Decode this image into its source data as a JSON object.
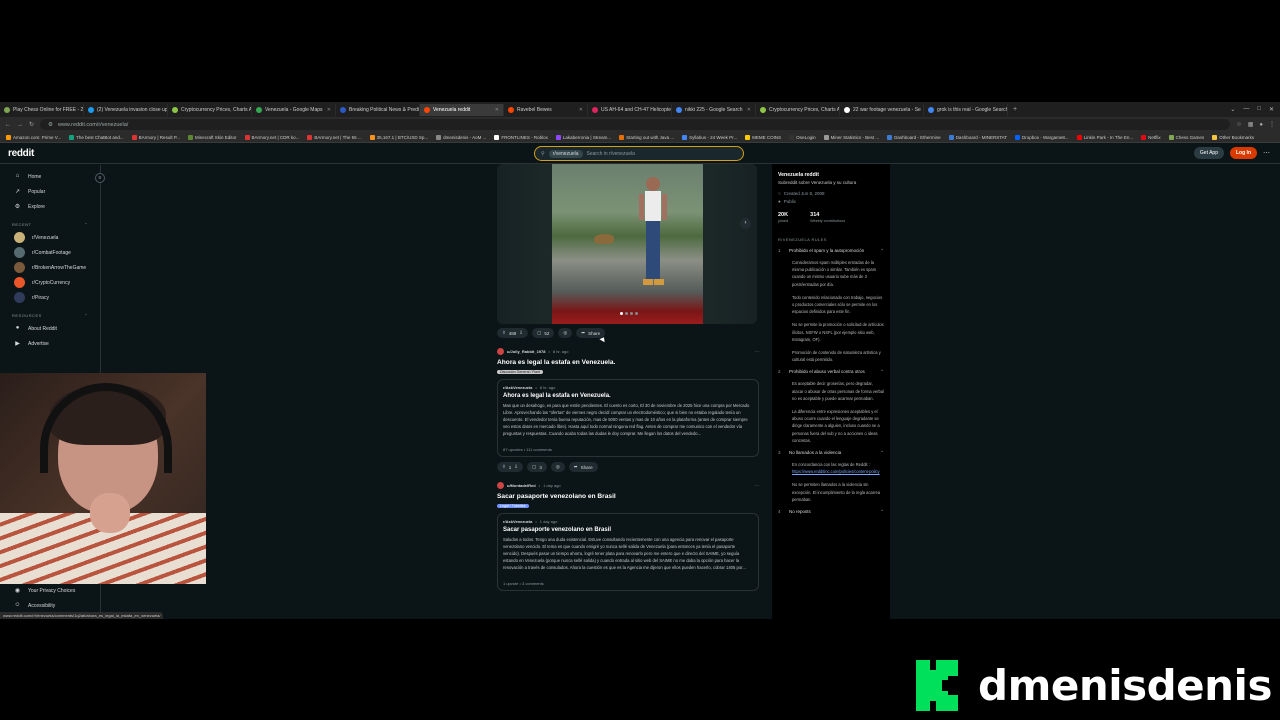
{
  "browser": {
    "tabs": [
      {
        "label": "Play Chess Online for FREE - 2 ×",
        "color": "#7fa650"
      },
      {
        "label": "(2) Venezuela invasion close up",
        "color": "#1d9bf0"
      },
      {
        "label": "Cryptocurrency Prices, Charts A",
        "color": "#8dc647"
      },
      {
        "label": "Venezuela - Google Maps",
        "color": "#34a853"
      },
      {
        "label": "Breaking Political News & Predi",
        "color": "#2b59c3"
      },
      {
        "label": "Venezuela reddit",
        "color": "#ff4500",
        "active": true
      },
      {
        "label": "Ravebel Bewes",
        "color": "#ff4500"
      },
      {
        "label": "US AH-64 and CH-47 Helicopte",
        "color": "#e0245e"
      },
      {
        "label": "nikki 225 - Google Search",
        "color": "#4285f4"
      },
      {
        "label": "Cryptocurrency Prices, Charts A",
        "color": "#8dc647"
      },
      {
        "label": "22 war footage venezuela - Se",
        "color": "#ffffff"
      },
      {
        "label": "grok is this real - Google Search",
        "color": "#4285f4"
      }
    ],
    "new_tab": "+",
    "url": "www.reddit.com/r/venezuela/",
    "bookmarks": [
      {
        "label": "Amazon.com: Prime V...",
        "color": "#ff9900"
      },
      {
        "label": "The best ChatBot and...",
        "color": "#10a37f"
      },
      {
        "label": "BArmory | Result P...",
        "color": "#d33"
      },
      {
        "label": "Minecraft Skin Editor",
        "color": "#5b8731"
      },
      {
        "label": "BArmory.net | CDR ko...",
        "color": "#d33"
      },
      {
        "label": "BArmory.net | The 55 ...",
        "color": "#d33"
      },
      {
        "label": "35,167.1 | BTC/USD Sp...",
        "color": "#f7931a"
      },
      {
        "label": "dmenisdenis - AoM ...",
        "color": "#888"
      },
      {
        "label": "FRONTLINES - Roblox",
        "color": "#fff"
      },
      {
        "label": "Lakaberronia | Stream...",
        "color": "#9146ff"
      },
      {
        "label": "Starting out with Java ...",
        "color": "#e76f00"
      },
      {
        "label": "Syllabus - 24 Week Pr...",
        "color": "#4285f4"
      },
      {
        "label": "MEME COINS",
        "color": "#ffcc00"
      },
      {
        "label": "OneLogin",
        "color": "#333"
      },
      {
        "label": "Miner Statistics - Best ...",
        "color": "#999"
      },
      {
        "label": "Dashboard - Ethermine",
        "color": "#3a7bd5"
      },
      {
        "label": "Dashboard - MINERSTAT",
        "color": "#3a7bd5"
      },
      {
        "label": "Dropbox - Wargame8...",
        "color": "#0061ff"
      },
      {
        "label": "Linkin Park - In The En...",
        "color": "#e00"
      },
      {
        "label": "Netflix",
        "color": "#e50914"
      },
      {
        "label": "Chess Games",
        "color": "#7fa650"
      },
      {
        "label": "Other Bookmarks",
        "color": "#f4c542"
      }
    ]
  },
  "reddit": {
    "logo": "reddit",
    "search": {
      "chip": "r/venezuela",
      "placeholder": "Search in r/venezuela"
    },
    "get_app": "Get App",
    "login": "Log In",
    "nav": {
      "home": "Home",
      "popular": "Popular",
      "explore": "Explore",
      "recent_header": "RECENT",
      "recent": [
        {
          "label": "r/Venezuela",
          "color": "#c9b27a"
        },
        {
          "label": "r/CombatFootage",
          "color": "#556b6f"
        },
        {
          "label": "r/BrokenArrowTheGame",
          "color": "#7a5a3a"
        },
        {
          "label": "r/CryptoCurrency",
          "color": "#e8562a"
        },
        {
          "label": "r/Piracy",
          "color": "#2f3b5a"
        }
      ],
      "resources_header": "RESOURCES",
      "resources": [
        "About Reddit",
        "Advertise"
      ],
      "bottom": [
        "Your Privacy Choices",
        "Accessibility"
      ]
    },
    "feed": {
      "first_actions": {
        "votes": "488",
        "comments": "52",
        "share": "Share"
      },
      "posts": [
        {
          "user": "u/Jolly_Rabbit_1978",
          "age": "8 hr. ago",
          "title": "Ahora es legal la estafa en Venezuela.",
          "flair": "Discusión General / Rant",
          "flair_blue": false,
          "x_sub": "r/AskVenezuela",
          "x_age": "8 hr. ago",
          "x_title": "Ahora es legal la estafa en Venezuela.",
          "x_body": "Mas que un desahogo, es para que estén pendientes. El cuento es corto, El 30 de noviembre de 2025 hice una compra por Mercado Libre. Aprovechando las \"ofertas\" de viernes negro decidí comprar un electrodoméstico; que si bien no estaba regalado tenía un descuento. El vendedor tenía buena reputación, mas de 5000 ventas y mas de 10 años en la plataforma (antes de comprar siempre veo estos datos en mercado libre). Hasta aquí todo normal ninguna red flag. Antes de comprar me comunico con el vendedor vía preguntas y respuestas. Cuando acabo todas las dudas le doy comprar. Me llegan los datos del vendedo...",
          "upvotes": "87 upvotes",
          "comments": "111 comments",
          "votes": "1",
          "ncomments": "3",
          "share": "Share"
        },
        {
          "user": "u/MontadelRed",
          "age": "1 day ago",
          "title": "Sacar pasaporte venezolano en Brasil",
          "flair": "Legal / Trámites",
          "flair_blue": true,
          "x_sub": "r/AskVenezuela",
          "x_age": "1 day ago",
          "x_title": "Sacar pasaporte venezolano en Brasil",
          "x_body": "Saludos a todos. Tengo una duda existencial. Estuve consultando recientemente con una agencia para renovar el pasaporte venezolano vencido. El tema es que cuando emigré yo nunca sellé salida de Venezuela (para entonces ya tenía el pasaporte vencido). Después pasar un tiempo ahorra, logré tener plata para renovarlo pero me entero que e directo del SAIME, yo seguía estando en Venezuela (porque nunca sellé salida) y cuando entrada al sitio web del SAIME no me daba la opción para hacer la renovación a través de consulados. Ahora la cuestión es que es la Agencia me dijeron que ellos pueden hacerlo, cobrar 1405 por...",
          "upvotes": "1 upvote",
          "comments": "3 comments"
        }
      ]
    },
    "sidebar": {
      "name": "Venezuela reddit",
      "desc": "Subreddit sobre Venezuela y su cultura",
      "created": "Created Jun 8, 2008",
      "visibility": "Public",
      "members": "20K",
      "members_label": "joined",
      "contributions": "314",
      "contributions_label": "Weekly contributions",
      "rules_header": "R/VENEZUELA RULES",
      "rules": [
        {
          "n": "1",
          "title": "Prohibido el spam y la autopromoción",
          "body": [
            "Consideramos spam múltiples entradas de la misma publicación o similar. También es spam cuando un mismo usuario sube más de 3 posts/entradas por día.",
            "Todo contenido relacionado con trabajo, negocios o productos comerciales sólo se permite en los espacios definidos para este fin.",
            "No se permite la promoción o solicitud de artículos ilícitos, NSFW o NSFL (por ejemplo sitio web, Instagram, OF).",
            "Promoción de contenido de naturaleza artística y cultural está permitido."
          ]
        },
        {
          "n": "2",
          "title": "Prohibido el abuso verbal contra otros",
          "body": [
            "Es aceptable decir groserías, pero degradar, atacar o abusar de otras personas de forma verbal no es aceptable y puede acarrear permaban.",
            "La diferencia entre expresiones aceptables y el abuso ocurre cuando el lenguaje degradante se dirige claramente a alguien, incluso cuando se a personas fuera del sub y no a acciones o ideas concretas."
          ]
        },
        {
          "n": "3",
          "title": "No llamados a la violencia",
          "body": [
            "En concordancia con las reglas de Reddit :",
            "No se permiten llamados a la violencia sin excepción. El incumplimiento de la regla acarrea permaban."
          ],
          "link": "https://www.redditinc.com/policies/content-policy"
        },
        {
          "n": "4",
          "title": "No reposts",
          "body": []
        }
      ]
    }
  },
  "status_url": "www.reddit.com/r/Venezuela/comments/1q2ab/ahora_es_legal_la_estafa_en_venezuela/",
  "channel": {
    "name": "dmenisdenis",
    "accent": "#00e05a"
  }
}
